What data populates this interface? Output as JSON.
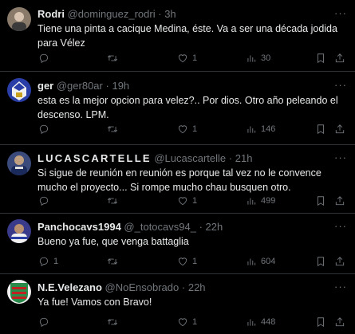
{
  "tweets": [
    {
      "name": "Rodri",
      "handle": "@dominguez_rodri",
      "dot": "·",
      "time": "3h",
      "text": "Tiene una pinta a cacique Medina, éste. Va a ser una década jodida para Vélez",
      "replies": "",
      "retweets": "",
      "likes": "1",
      "views": "30",
      "avatar_color": "#8a7a6a"
    },
    {
      "name": "ger",
      "handle": "@ger80ar",
      "dot": "·",
      "time": "19h",
      "text": "esta es la mejor opcion para velez?.. Por dios. Otro año peleando el descenso. LPM.",
      "replies": "",
      "retweets": "",
      "likes": "1",
      "views": "146",
      "avatar_color": "#2a3ea8"
    },
    {
      "name": "LUCASCARTELLE",
      "handle": "@Lucascartelle",
      "dot": "·",
      "time": "21h",
      "text": "Si sigue de reunión en reunión es porque tal vez no le convence mucho el proyecto... Si rompe mucho chau busquen otro.",
      "replies": "",
      "retweets": "",
      "likes": "1",
      "views": "499",
      "avatar_color": "#3a4a7a"
    },
    {
      "name": "Panchocavs1994",
      "handle": "@_totocavs94_",
      "dot": "·",
      "time": "22h",
      "text": "Bueno ya fue, que venga battaglia",
      "replies": "1",
      "retweets": "",
      "likes": "1",
      "views": "604",
      "avatar_color": "#3a3a8a"
    },
    {
      "name": "N.E.Velezano",
      "handle": "@NoEnsobrado",
      "dot": "·",
      "time": "22h",
      "text": "Ya fue! Vamos con Bravo!",
      "replies": "",
      "retweets": "",
      "likes": "1",
      "views": "448",
      "avatar_color": "#2a8a4a"
    }
  ],
  "icons": {
    "more": "more-horizontal-icon",
    "reply": "reply-icon",
    "retweet": "retweet-icon",
    "like": "heart-icon",
    "views": "views-icon",
    "bookmark": "bookmark-icon",
    "share": "share-icon"
  },
  "colors": {
    "background": "#000000",
    "text": "#e7e9ea",
    "muted": "#71767b",
    "divider": "#2f3336"
  }
}
